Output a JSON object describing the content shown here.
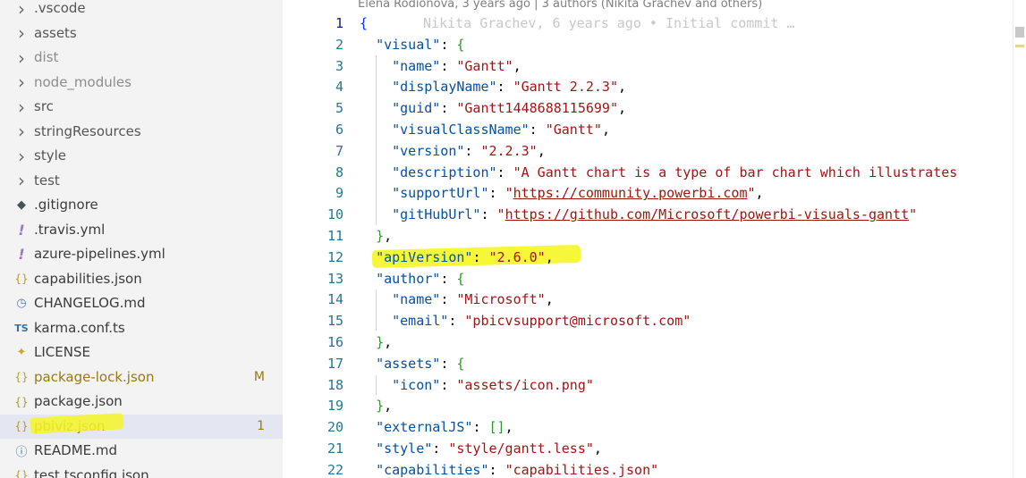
{
  "sidebar": {
    "items": [
      {
        "label": ".vscode",
        "kind": "folder",
        "icon": "chevron-right-icon",
        "glyph": "›",
        "color": "#555555"
      },
      {
        "label": "assets",
        "kind": "folder",
        "icon": "chevron-right-icon",
        "glyph": "›",
        "color": "#555555"
      },
      {
        "label": "dist",
        "kind": "folder",
        "icon": "chevron-right-icon",
        "glyph": "›",
        "color": "#8c8c8c"
      },
      {
        "label": "node_modules",
        "kind": "folder",
        "icon": "chevron-right-icon",
        "glyph": "›",
        "color": "#8c8c8c"
      },
      {
        "label": "src",
        "kind": "folder",
        "icon": "chevron-right-icon",
        "glyph": "›",
        "color": "#555555"
      },
      {
        "label": "stringResources",
        "kind": "folder",
        "icon": "chevron-right-icon",
        "glyph": "›",
        "color": "#555555"
      },
      {
        "label": "style",
        "kind": "folder",
        "icon": "chevron-right-icon",
        "glyph": "›",
        "color": "#555555"
      },
      {
        "label": "test",
        "kind": "folder",
        "icon": "chevron-right-icon",
        "glyph": "›",
        "color": "#555555"
      },
      {
        "label": ".gitignore",
        "kind": "file",
        "icon": "git-icon",
        "glyph": "◆",
        "iconColor": "#41535b",
        "color": "#3b3b3b"
      },
      {
        "label": ".travis.yml",
        "kind": "file",
        "icon": "yaml-icon",
        "glyph": "!",
        "iconColor": "#a074c4",
        "color": "#3b3b3b"
      },
      {
        "label": "azure-pipelines.yml",
        "kind": "file",
        "icon": "yaml-icon",
        "glyph": "!",
        "iconColor": "#a074c4",
        "color": "#3b3b3b"
      },
      {
        "label": "capabilities.json",
        "kind": "file",
        "icon": "json-icon",
        "glyph": "{}",
        "iconColor": "#b59a2e",
        "color": "#3b3b3b"
      },
      {
        "label": "CHANGELOG.md",
        "kind": "file",
        "icon": "clock-icon",
        "glyph": "◷",
        "iconColor": "#4a7fb5",
        "color": "#3b3b3b"
      },
      {
        "label": "karma.conf.ts",
        "kind": "file",
        "icon": "typescript-icon",
        "glyph": "TS",
        "iconColor": "#3a6ea5",
        "color": "#3b3b3b"
      },
      {
        "label": "LICENSE",
        "kind": "file",
        "icon": "license-icon",
        "glyph": "✦",
        "iconColor": "#c8a832",
        "color": "#3b3b3b"
      },
      {
        "label": "package-lock.json",
        "kind": "file",
        "icon": "json-icon",
        "glyph": "{}",
        "iconColor": "#b59a2e",
        "color": "#9a7a10",
        "badge": "M"
      },
      {
        "label": "package.json",
        "kind": "file",
        "icon": "json-icon",
        "glyph": "{}",
        "iconColor": "#b59a2e",
        "color": "#3b3b3b"
      },
      {
        "label": "pbiviz.json",
        "kind": "file",
        "icon": "json-icon",
        "glyph": "{}",
        "iconColor": "#b59a2e",
        "color": "#9a7a10",
        "badge": "1",
        "selected": true
      },
      {
        "label": "README.md",
        "kind": "file",
        "icon": "info-icon",
        "glyph": "ⓘ",
        "iconColor": "#3a6ea5",
        "color": "#3b3b3b"
      },
      {
        "label": "test.tsconfig.json",
        "kind": "file",
        "icon": "json-icon",
        "glyph": "{}",
        "iconColor": "#b59a2e",
        "color": "#3b3b3b"
      }
    ]
  },
  "editor": {
    "blame_header": "Elena Rodionova, 3 years ago | 3 authors (Nikita Grachev and others)",
    "inline_blame": "Nikita Grachev, 6 years ago • Initial commit …",
    "lines": [
      [
        {
          "t": "{",
          "c": "br"
        }
      ],
      [
        {
          "t": "  "
        },
        {
          "t": "\"visual\"",
          "c": "k"
        },
        {
          "t": ": "
        },
        {
          "t": "{",
          "c": "br2"
        }
      ],
      [
        {
          "t": "    "
        },
        {
          "t": "\"name\"",
          "c": "k"
        },
        {
          "t": ": "
        },
        {
          "t": "\"Gantt\"",
          "c": "s"
        },
        {
          "t": ","
        }
      ],
      [
        {
          "t": "    "
        },
        {
          "t": "\"displayName\"",
          "c": "k"
        },
        {
          "t": ": "
        },
        {
          "t": "\"Gantt 2.2.3\"",
          "c": "s"
        },
        {
          "t": ","
        }
      ],
      [
        {
          "t": "    "
        },
        {
          "t": "\"guid\"",
          "c": "k"
        },
        {
          "t": ": "
        },
        {
          "t": "\"Gantt1448688115699\"",
          "c": "s"
        },
        {
          "t": ","
        }
      ],
      [
        {
          "t": "    "
        },
        {
          "t": "\"visualClassName\"",
          "c": "k"
        },
        {
          "t": ": "
        },
        {
          "t": "\"Gantt\"",
          "c": "s"
        },
        {
          "t": ","
        }
      ],
      [
        {
          "t": "    "
        },
        {
          "t": "\"version\"",
          "c": "k"
        },
        {
          "t": ": "
        },
        {
          "t": "\"2.2.3\"",
          "c": "s"
        },
        {
          "t": ","
        }
      ],
      [
        {
          "t": "    "
        },
        {
          "t": "\"description\"",
          "c": "k"
        },
        {
          "t": ": "
        },
        {
          "t": "\"A Gantt chart is a type of bar chart which illustrates",
          "c": "s"
        }
      ],
      [
        {
          "t": "    "
        },
        {
          "t": "\"supportUrl\"",
          "c": "k"
        },
        {
          "t": ": "
        },
        {
          "t": "\"",
          "c": "s"
        },
        {
          "t": "https://community.powerbi.com",
          "c": "s u"
        },
        {
          "t": "\"",
          "c": "s"
        },
        {
          "t": ","
        }
      ],
      [
        {
          "t": "    "
        },
        {
          "t": "\"gitHubUrl\"",
          "c": "k"
        },
        {
          "t": ": "
        },
        {
          "t": "\"",
          "c": "s"
        },
        {
          "t": "https://github.com/Microsoft/powerbi-visuals-gantt",
          "c": "s u"
        },
        {
          "t": "\"",
          "c": "s"
        }
      ],
      [
        {
          "t": "  "
        },
        {
          "t": "}",
          "c": "br2"
        },
        {
          "t": ","
        }
      ],
      [
        {
          "t": "  "
        },
        {
          "t": "\"apiVersion\"",
          "c": "k"
        },
        {
          "t": ": "
        },
        {
          "t": "\"2.6.0\"",
          "c": "s"
        },
        {
          "t": ","
        }
      ],
      [
        {
          "t": "  "
        },
        {
          "t": "\"author\"",
          "c": "k"
        },
        {
          "t": ": "
        },
        {
          "t": "{",
          "c": "br2"
        }
      ],
      [
        {
          "t": "    "
        },
        {
          "t": "\"name\"",
          "c": "k"
        },
        {
          "t": ": "
        },
        {
          "t": "\"Microsoft\"",
          "c": "s"
        },
        {
          "t": ","
        }
      ],
      [
        {
          "t": "    "
        },
        {
          "t": "\"email\"",
          "c": "k"
        },
        {
          "t": ": "
        },
        {
          "t": "\"pbicvsupport@microsoft.com\"",
          "c": "s"
        }
      ],
      [
        {
          "t": "  "
        },
        {
          "t": "}",
          "c": "br2"
        },
        {
          "t": ","
        }
      ],
      [
        {
          "t": "  "
        },
        {
          "t": "\"assets\"",
          "c": "k"
        },
        {
          "t": ": "
        },
        {
          "t": "{",
          "c": "br2"
        }
      ],
      [
        {
          "t": "    "
        },
        {
          "t": "\"icon\"",
          "c": "k"
        },
        {
          "t": ": "
        },
        {
          "t": "\"assets/icon.png\"",
          "c": "s"
        }
      ],
      [
        {
          "t": "  "
        },
        {
          "t": "}",
          "c": "br2"
        },
        {
          "t": ","
        }
      ],
      [
        {
          "t": "  "
        },
        {
          "t": "\"externalJS\"",
          "c": "k"
        },
        {
          "t": ": "
        },
        {
          "t": "[]",
          "c": "br2"
        },
        {
          "t": ","
        }
      ],
      [
        {
          "t": "  "
        },
        {
          "t": "\"style\"",
          "c": "k"
        },
        {
          "t": ": "
        },
        {
          "t": "\"style/gantt.less\"",
          "c": "s"
        },
        {
          "t": ","
        }
      ],
      [
        {
          "t": "  "
        },
        {
          "t": "\"capabilities\"",
          "c": "k"
        },
        {
          "t": ": "
        },
        {
          "t": "\"capabilities.json\"",
          "c": "s"
        }
      ]
    ]
  }
}
